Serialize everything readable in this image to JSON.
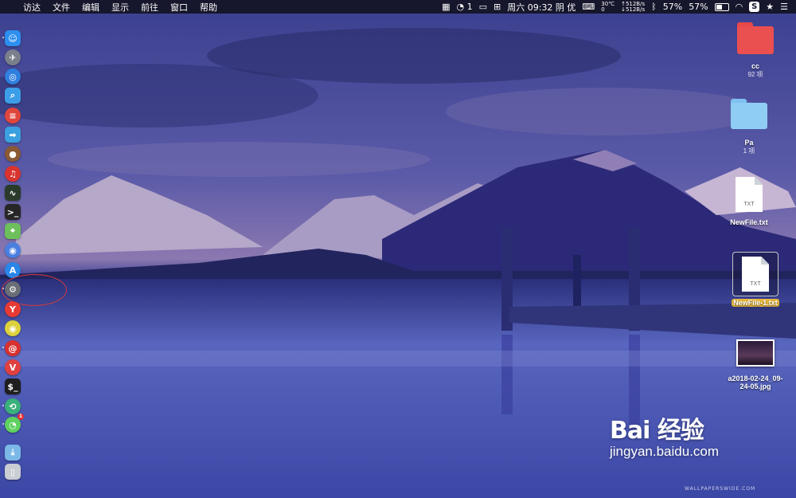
{
  "menubar": {
    "apple": "",
    "menus": [
      "访达",
      "文件",
      "编辑",
      "显示",
      "前往",
      "窗口",
      "帮助"
    ],
    "status": {
      "wechat_count": "1",
      "clock": "周六 09:32",
      "weather": "阴",
      "air": "优",
      "temperature": "30℃",
      "temp_sub": "0",
      "net_up": "↑512B/s",
      "net_down": "↓512B/s",
      "battery_a": "57%",
      "battery_b": "57%",
      "s_icon": "S",
      "star": "★"
    }
  },
  "dock": {
    "apps": [
      {
        "name": "finder",
        "color": "#2d8ff0",
        "glyph": "☺",
        "dot": true
      },
      {
        "name": "launchpad",
        "color": "#7a7f8c",
        "glyph": "✈",
        "round": true
      },
      {
        "name": "safari",
        "color": "#2f7fe0",
        "glyph": "◎",
        "round": true
      },
      {
        "name": "preview",
        "color": "#3c9ee8",
        "glyph": "⌕"
      },
      {
        "name": "calculator",
        "color": "#e0463c",
        "glyph": "≡",
        "round": true
      },
      {
        "name": "migration",
        "color": "#3aa0e0",
        "glyph": "➡"
      },
      {
        "name": "basketball",
        "color": "#8a5a34",
        "glyph": "●",
        "round": true
      },
      {
        "name": "netease-music",
        "color": "#d9342f",
        "glyph": "♫",
        "round": true
      },
      {
        "name": "activity-monitor",
        "color": "#2b3b2b",
        "glyph": "∿"
      },
      {
        "name": "terminal",
        "color": "#262626",
        "glyph": ">_"
      },
      {
        "name": "maps",
        "color": "#6cbf5a",
        "glyph": "⌖"
      },
      {
        "name": "siri",
        "color": "#4a7fe0",
        "glyph": "◉",
        "round": true
      },
      {
        "name": "app-store",
        "color": "#2a86e8",
        "glyph": "A",
        "round": true
      },
      {
        "name": "system-preferences",
        "color": "#6a6e76",
        "glyph": "⚙",
        "round": true,
        "dot": true
      },
      {
        "name": "yandex",
        "color": "#e83a34",
        "glyph": "Y",
        "round": true
      },
      {
        "name": "chrome",
        "color": "#dcd13a",
        "glyph": "◉",
        "round": true
      },
      {
        "name": "weibo",
        "color": "#d83030",
        "glyph": "@",
        "round": true,
        "dot": true
      },
      {
        "name": "vivaldi",
        "color": "#e04040",
        "glyph": "V",
        "round": true
      },
      {
        "name": "terminal-2",
        "color": "#1e1e1e",
        "glyph": "$_"
      },
      {
        "name": "app-green",
        "color": "#3ab07a",
        "glyph": "⟲",
        "round": true,
        "dot": true
      },
      {
        "name": "wechat",
        "color": "#5fd15f",
        "glyph": "◔",
        "round": true,
        "badge": "1",
        "dot": true
      },
      {
        "name": "downloads-folder",
        "color": "#7bb8e8",
        "glyph": "⤓"
      },
      {
        "name": "trash",
        "color": "#c9cdd4",
        "glyph": "▯"
      }
    ]
  },
  "desktop": {
    "items": [
      {
        "label": "cc",
        "sub": "92 项"
      },
      {
        "label": "Pa",
        "sub": "1 项"
      },
      {
        "label": "NewFile.txt",
        "ext": "TXT"
      },
      {
        "label": "NewFile-1.txt",
        "ext": "TXT",
        "selected": true
      },
      {
        "label": "a2018-02-24_09-24-05.jpg"
      }
    ]
  },
  "watermark": {
    "brand": "Bai 经验",
    "url": "jingyan.baidu.com",
    "credit": "WALLPAPERSWIDE.COM"
  }
}
